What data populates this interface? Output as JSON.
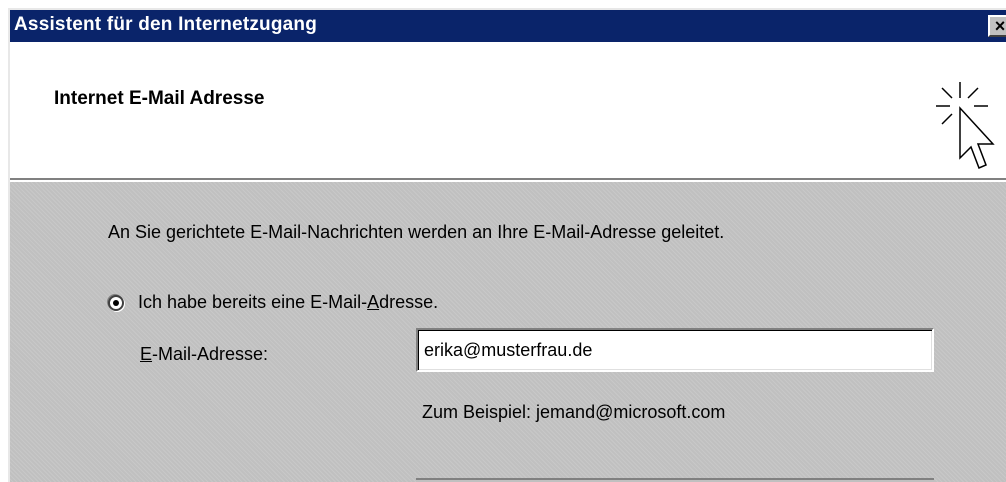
{
  "window": {
    "title": "Assistent für den Internetzugang",
    "close_glyph": "×"
  },
  "header": {
    "title": "Internet E-Mail Adresse",
    "icon": "wizard-cursor-icon"
  },
  "body": {
    "description": "An Sie gerichtete E-Mail-Nachrichten werden an Ihre E-Mail-Adresse geleitet.",
    "radio_existing": {
      "label_before": "Ich habe bereits eine E-Mail-",
      "label_mnemonic": "A",
      "label_after": "dresse.",
      "checked": true
    },
    "email_field": {
      "label_mnemonic": "E",
      "label_rest": "-Mail-Adresse:",
      "value": "erika@musterfrau.de"
    },
    "example": "Zum Beispiel: jemand@microsoft.com"
  },
  "colors": {
    "titlebar": "#0a246a",
    "dialog_face": "#c0c0c0",
    "header_bg": "#ffffff"
  }
}
